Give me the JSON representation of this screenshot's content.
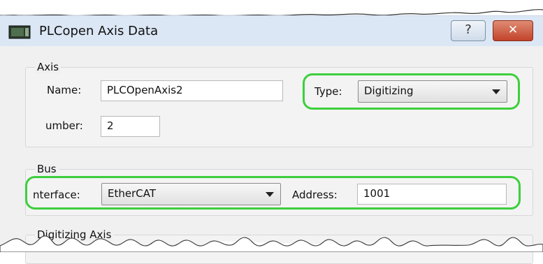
{
  "window": {
    "title": "PLCopen Axis Data",
    "help_glyph": "?",
    "close_glyph": "✕"
  },
  "axis_group": {
    "title": "Axis",
    "name_label": "Name:",
    "name_value": "PLCOpenAxis2",
    "type_label": "Type:",
    "type_value": "Digitizing",
    "number_label": "umber:",
    "number_value": "2"
  },
  "bus_group": {
    "title": "Bus",
    "interface_label": "nterface:",
    "interface_value": "EtherCAT",
    "address_label": "Address:",
    "address_value": "1001"
  },
  "digitizing_group": {
    "title": "Digitizing Axis"
  },
  "colors": {
    "highlight": "#3ccf3c",
    "close_button": "#c2432a",
    "titlebar": "#dbe7f5"
  },
  "icons": {
    "app": "plcopen-window-icon",
    "help": "question-icon",
    "close": "close-icon",
    "dropdown": "chevron-down-icon"
  }
}
